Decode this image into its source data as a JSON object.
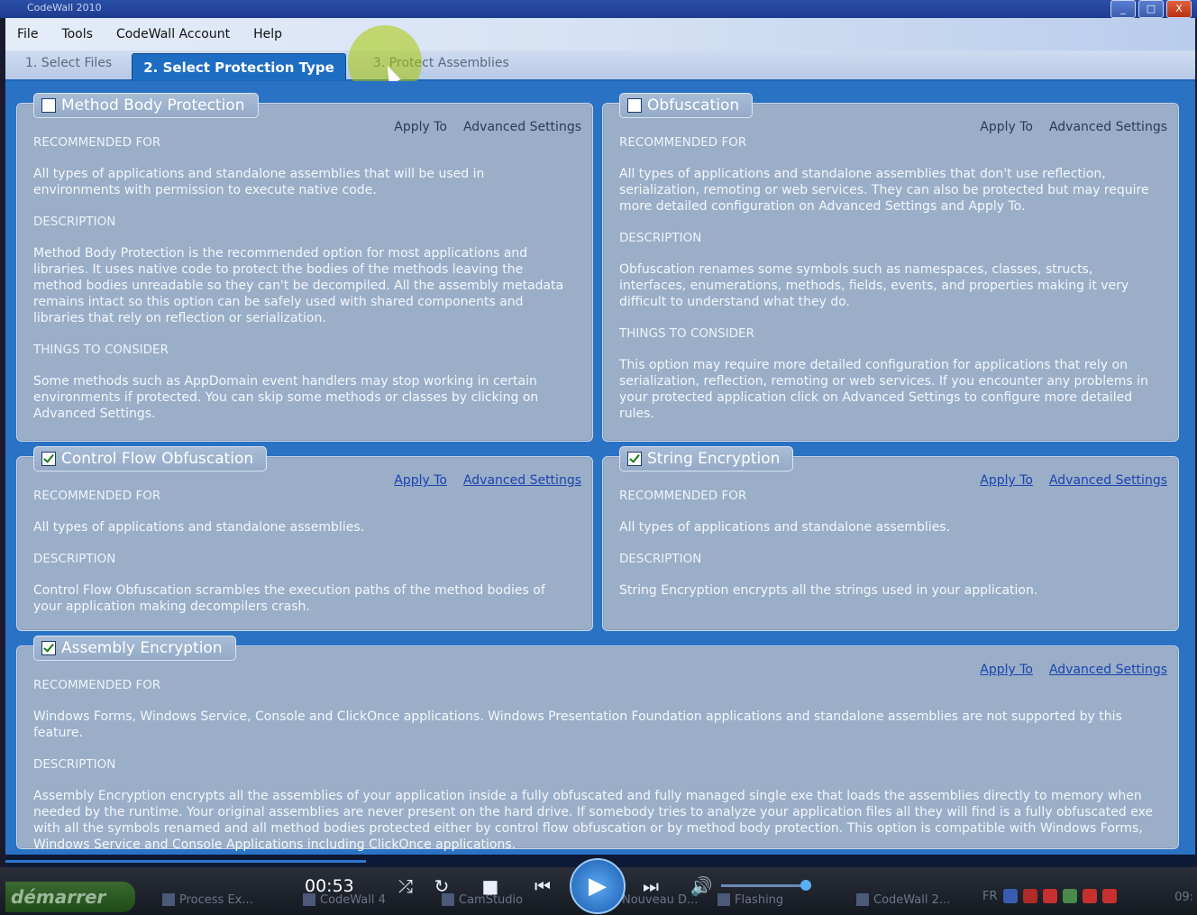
{
  "window": {
    "title": "CodeWall 2010",
    "buttons": [
      "_",
      "□",
      "X"
    ]
  },
  "menu": [
    "File",
    "Tools",
    "CodeWall Account",
    "Help"
  ],
  "tabs": [
    "1. Select Files",
    "2. Select Protection Type",
    "3. Protect Assemblies"
  ],
  "active_tab_index": 1,
  "panels": [
    {
      "title": "Method Body Protection",
      "checked": false,
      "apply_to": "Apply To",
      "advanced": "Advanced Settings",
      "links_active": false,
      "sections": [
        {
          "heading": "RECOMMENDED FOR",
          "text": "All types of applications and standalone assemblies that will be used in environments with permission to execute native code."
        },
        {
          "heading": "DESCRIPTION",
          "text": "Method Body Protection is the recommended option for most applications and libraries. It uses native code to protect the bodies of the methods leaving the method bodies unreadable so they can't be decompiled. All the assembly metadata remains intact so this option can be safely used with shared components and libraries that rely on reflection or serialization."
        },
        {
          "heading": "THINGS TO CONSIDER",
          "text": "Some methods such as AppDomain event handlers may stop working in certain environments if protected. You can skip some methods or classes by clicking on Advanced Settings."
        }
      ]
    },
    {
      "title": "Obfuscation",
      "checked": false,
      "apply_to": "Apply To",
      "advanced": "Advanced Settings",
      "links_active": false,
      "sections": [
        {
          "heading": "RECOMMENDED FOR",
          "text": "All types of applications and standalone assemblies that don't use reflection, serialization, remoting or web services. They can also be protected but may require more detailed configuration on Advanced Settings and Apply To."
        },
        {
          "heading": "DESCRIPTION",
          "text": "Obfuscation renames some symbols such as namespaces, classes, structs, interfaces, enumerations, methods, fields, events, and properties making it very difficult to understand what they do."
        },
        {
          "heading": "THINGS TO CONSIDER",
          "text": "This option may require more detailed configuration for applications that rely on serialization, reflection, remoting or web services. If you encounter any problems in your protected application click on Advanced Settings to configure more detailed rules."
        }
      ]
    },
    {
      "title": "Control Flow Obfuscation",
      "checked": true,
      "apply_to": "Apply To",
      "advanced": "Advanced Settings",
      "links_active": true,
      "sections": [
        {
          "heading": "RECOMMENDED FOR",
          "text": "All types of applications and standalone assemblies."
        },
        {
          "heading": "DESCRIPTION",
          "text": "Control Flow Obfuscation scrambles the execution paths of the method bodies of your application making decompilers crash."
        }
      ]
    },
    {
      "title": "String Encryption",
      "checked": true,
      "apply_to": "Apply To",
      "advanced": "Advanced Settings",
      "links_active": true,
      "sections": [
        {
          "heading": "RECOMMENDED FOR",
          "text": "All types of applications and standalone assemblies."
        },
        {
          "heading": "DESCRIPTION",
          "text": "String Encryption encrypts all the strings used in your application."
        }
      ]
    },
    {
      "title": "Assembly Encryption",
      "checked": true,
      "apply_to": "Apply To",
      "advanced": "Advanced Settings",
      "links_active": true,
      "sections": [
        {
          "heading": "RECOMMENDED FOR",
          "text": "Windows Forms, Windows Service, Console and ClickOnce applications. Windows Presentation Foundation applications and standalone assemblies are not supported by this feature."
        },
        {
          "heading": "DESCRIPTION",
          "text": "Assembly Encryption encrypts all the assemblies of your application inside a fully obfuscated and fully managed single exe that loads the assemblies directly to memory when needed by the runtime. Your original assemblies are never present on the hard drive. If somebody tries to analyze your application files all they will find is a fully obfuscated exe with all the symbols renamed and all method bodies protected either by control flow obfuscation or by method body protection. This option is compatible with Windows Forms, Windows Service and Console Applications including ClickOnce applications."
        }
      ]
    }
  ],
  "player": {
    "time": "00:53",
    "progress_fraction": 0.3,
    "volume_fraction": 0.88
  },
  "taskbar": {
    "start_label": "démarrer",
    "items": [
      "Process Ex...",
      "CodeWall 4",
      "CamStudio",
      "Nouveau D...",
      "Flashing",
      "CodeWall 2..."
    ],
    "lang": "FR",
    "clock": "09:"
  }
}
